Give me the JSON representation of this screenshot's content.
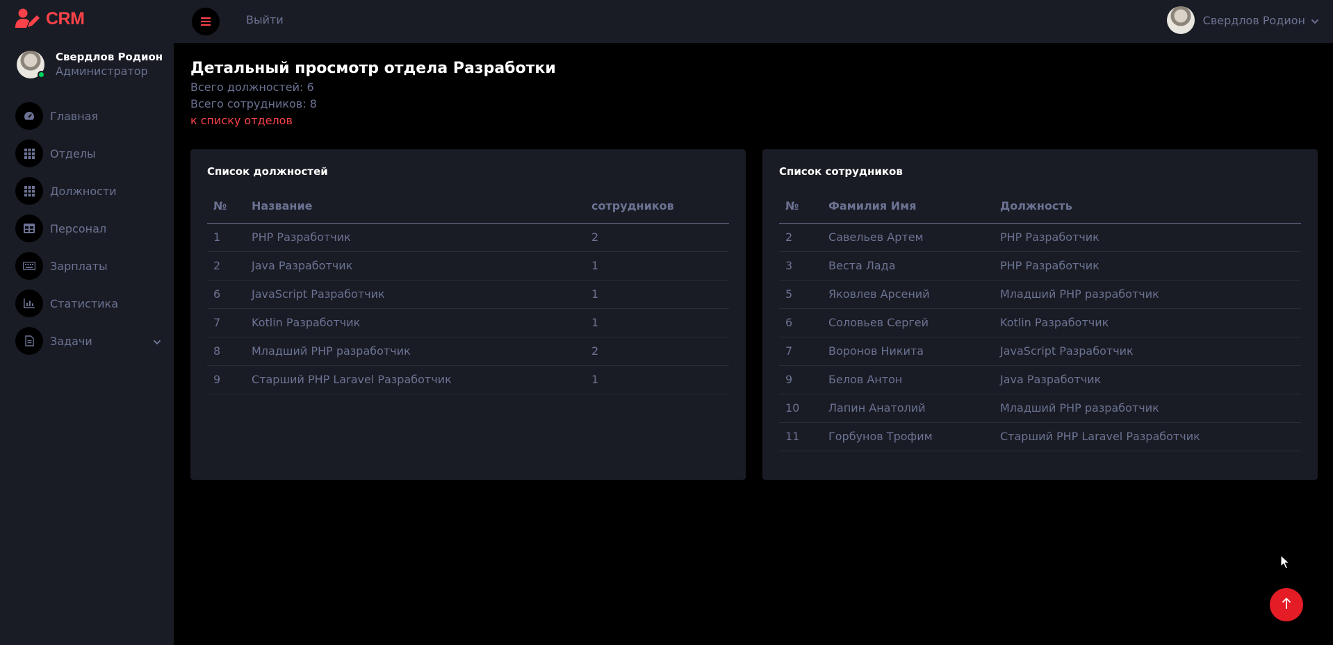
{
  "brand": {
    "name": "CRM",
    "color": "#fc424a",
    "icon": "user-edit-icon"
  },
  "sidebar": {
    "user": {
      "name": "Свердлов Родион",
      "role": "Администратор",
      "status": "online"
    },
    "items": [
      {
        "label": "Главная",
        "icon": "speedometer-icon"
      },
      {
        "label": "Отделы",
        "icon": "grid-icon"
      },
      {
        "label": "Должности",
        "icon": "grid-icon"
      },
      {
        "label": "Персонал",
        "icon": "table-icon"
      },
      {
        "label": "Зарплаты",
        "icon": "keyboard-icon"
      },
      {
        "label": "Статистика",
        "icon": "chart-icon"
      },
      {
        "label": "Задачи",
        "icon": "document-icon",
        "has_submenu": true
      }
    ]
  },
  "topbar": {
    "logout_label": "Выйти",
    "user_name": "Свердлов Родион"
  },
  "page": {
    "title": "Детальный просмотр отдела Разработки",
    "total_positions": "Всего должностей: 6",
    "total_employees": "Всего сотрудников: 8",
    "back_link": "к списку отделов"
  },
  "positions": {
    "title": "Список должностей",
    "headers": [
      "№",
      "Название",
      "сотрудников"
    ],
    "rows": [
      [
        "1",
        "PHP Разработчик",
        "2"
      ],
      [
        "2",
        "Java Разработчик",
        "1"
      ],
      [
        "6",
        "JavaScript Разработчик",
        "1"
      ],
      [
        "7",
        "Kotlin Разработчик",
        "1"
      ],
      [
        "8",
        "Младший PHP разработчик",
        "2"
      ],
      [
        "9",
        "Старший PHP Laravel Разработчик",
        "1"
      ]
    ]
  },
  "employees": {
    "title": "Список сотрудников",
    "headers": [
      "№",
      "Фамилия Имя",
      "Должность"
    ],
    "rows": [
      [
        "2",
        "Савельев Артем",
        "PHP Разработчик"
      ],
      [
        "3",
        "Веста Лада",
        "PHP Разработчик"
      ],
      [
        "5",
        "Яковлев Арсений",
        "Младший PHP разработчик"
      ],
      [
        "6",
        "Соловьев Сергей",
        "Kotlin Разработчик"
      ],
      [
        "7",
        "Воронов Никита",
        "JavaScript Разработчик"
      ],
      [
        "9",
        "Белов Антон",
        "Java Разработчик"
      ],
      [
        "10",
        "Лапин Анатолий",
        "Младший PHP разработчик"
      ],
      [
        "11",
        "Горбунов Трофим",
        "Старший PHP Laravel Разработчик"
      ]
    ]
  },
  "colors": {
    "accent": "#fc424a",
    "sidebar_bg": "#191c24",
    "page_bg": "#000000",
    "text_muted": "#6c7293",
    "online": "#00d25b"
  }
}
